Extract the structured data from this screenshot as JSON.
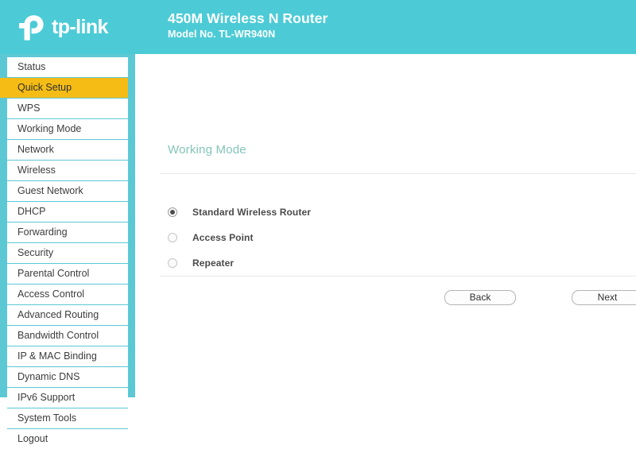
{
  "header": {
    "logo_icon": "tplink-logo-icon",
    "logo_text": "tp-link",
    "title": "450M Wireless N Router",
    "model": "Model No. TL-WR940N",
    "background_color": "#4ccbd6"
  },
  "sidebar": {
    "background_color": "#5bc8d4",
    "active_color": "#f5bc16",
    "active_index": 1,
    "items": [
      {
        "label": "Status"
      },
      {
        "label": "Quick Setup"
      },
      {
        "label": "WPS"
      },
      {
        "label": "Working Mode"
      },
      {
        "label": "Network"
      },
      {
        "label": "Wireless"
      },
      {
        "label": "Guest Network"
      },
      {
        "label": "DHCP"
      },
      {
        "label": "Forwarding"
      },
      {
        "label": "Security"
      },
      {
        "label": "Parental Control"
      },
      {
        "label": "Access Control"
      },
      {
        "label": "Advanced Routing"
      },
      {
        "label": "Bandwidth Control"
      },
      {
        "label": "IP & MAC Binding"
      },
      {
        "label": "Dynamic DNS"
      },
      {
        "label": "IPv6 Support"
      },
      {
        "label": "System Tools"
      },
      {
        "label": "Logout"
      }
    ]
  },
  "main": {
    "page_title": "Working Mode",
    "page_title_color": "#83c5b8",
    "options": [
      {
        "label": "Standard Wireless Router",
        "selected": true
      },
      {
        "label": "Access Point",
        "selected": false
      },
      {
        "label": "Repeater",
        "selected": false
      }
    ],
    "buttons": {
      "back_label": "Back",
      "next_label": "Next"
    }
  }
}
